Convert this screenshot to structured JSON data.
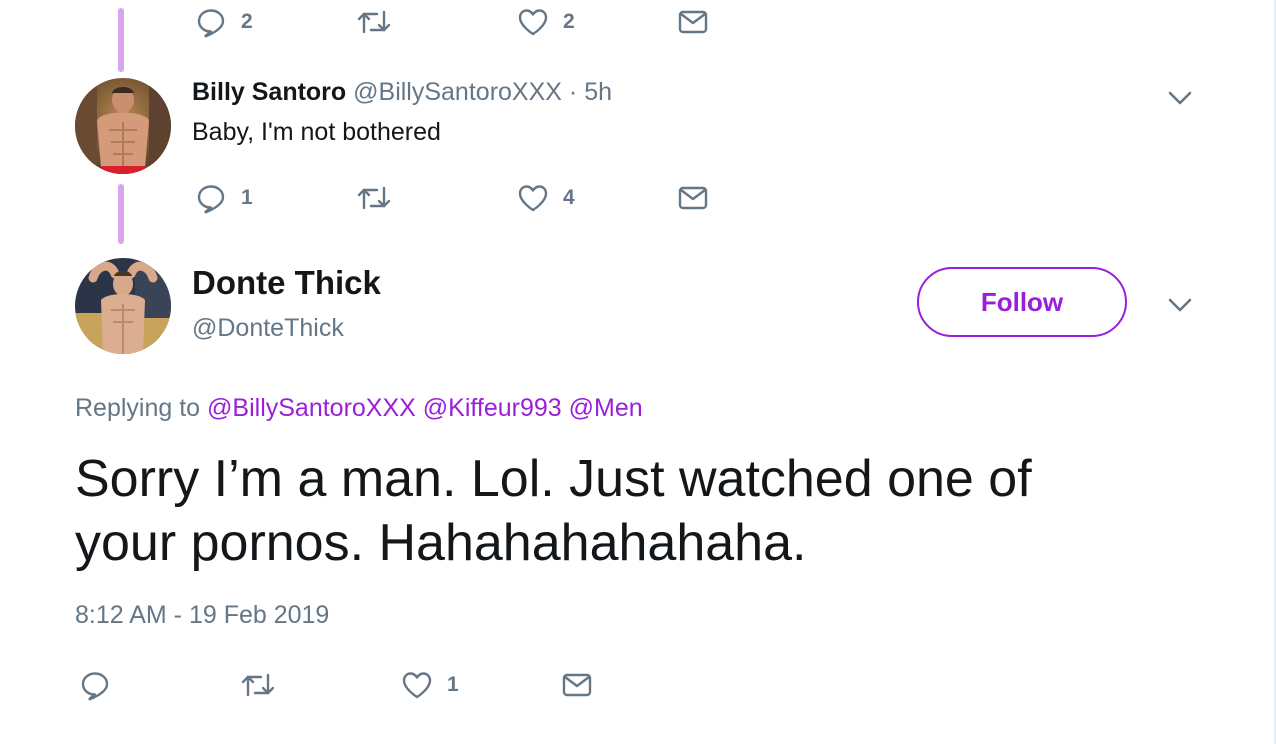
{
  "tweet_top": {
    "reply_count": "2",
    "retweet_count": "",
    "like_count": "2"
  },
  "reply": {
    "name": "Billy Santoro",
    "handle": "@BillySantoroXXX",
    "separator": "·",
    "time": "5h",
    "text": "Baby, I'm not bothered",
    "reply_count": "1",
    "retweet_count": "",
    "like_count": "4"
  },
  "main_tweet": {
    "name": "Donte Thick",
    "handle": "@DonteThick",
    "follow_label": "Follow",
    "replying_prefix": "Replying to",
    "mentions": [
      "@BillySantoroXXX",
      "@Kiffeur993",
      "@Men"
    ],
    "line1": "Sorry I’m a man. Lol. Just watched one of",
    "line2": "your pornos. Hahahahahahaha.",
    "timestamp": "8:12 AM - 19 Feb 2019",
    "reply_count": "",
    "retweet_count": "",
    "like_count": "1"
  },
  "colors": {
    "accent": "#9b1fd9",
    "thread_line": "#d7a6ee",
    "secondary_text": "#657786",
    "primary_text": "#14171a"
  },
  "icons": [
    "reply-icon",
    "retweet-icon",
    "like-icon",
    "direct-message-icon",
    "chevron-down-icon"
  ]
}
